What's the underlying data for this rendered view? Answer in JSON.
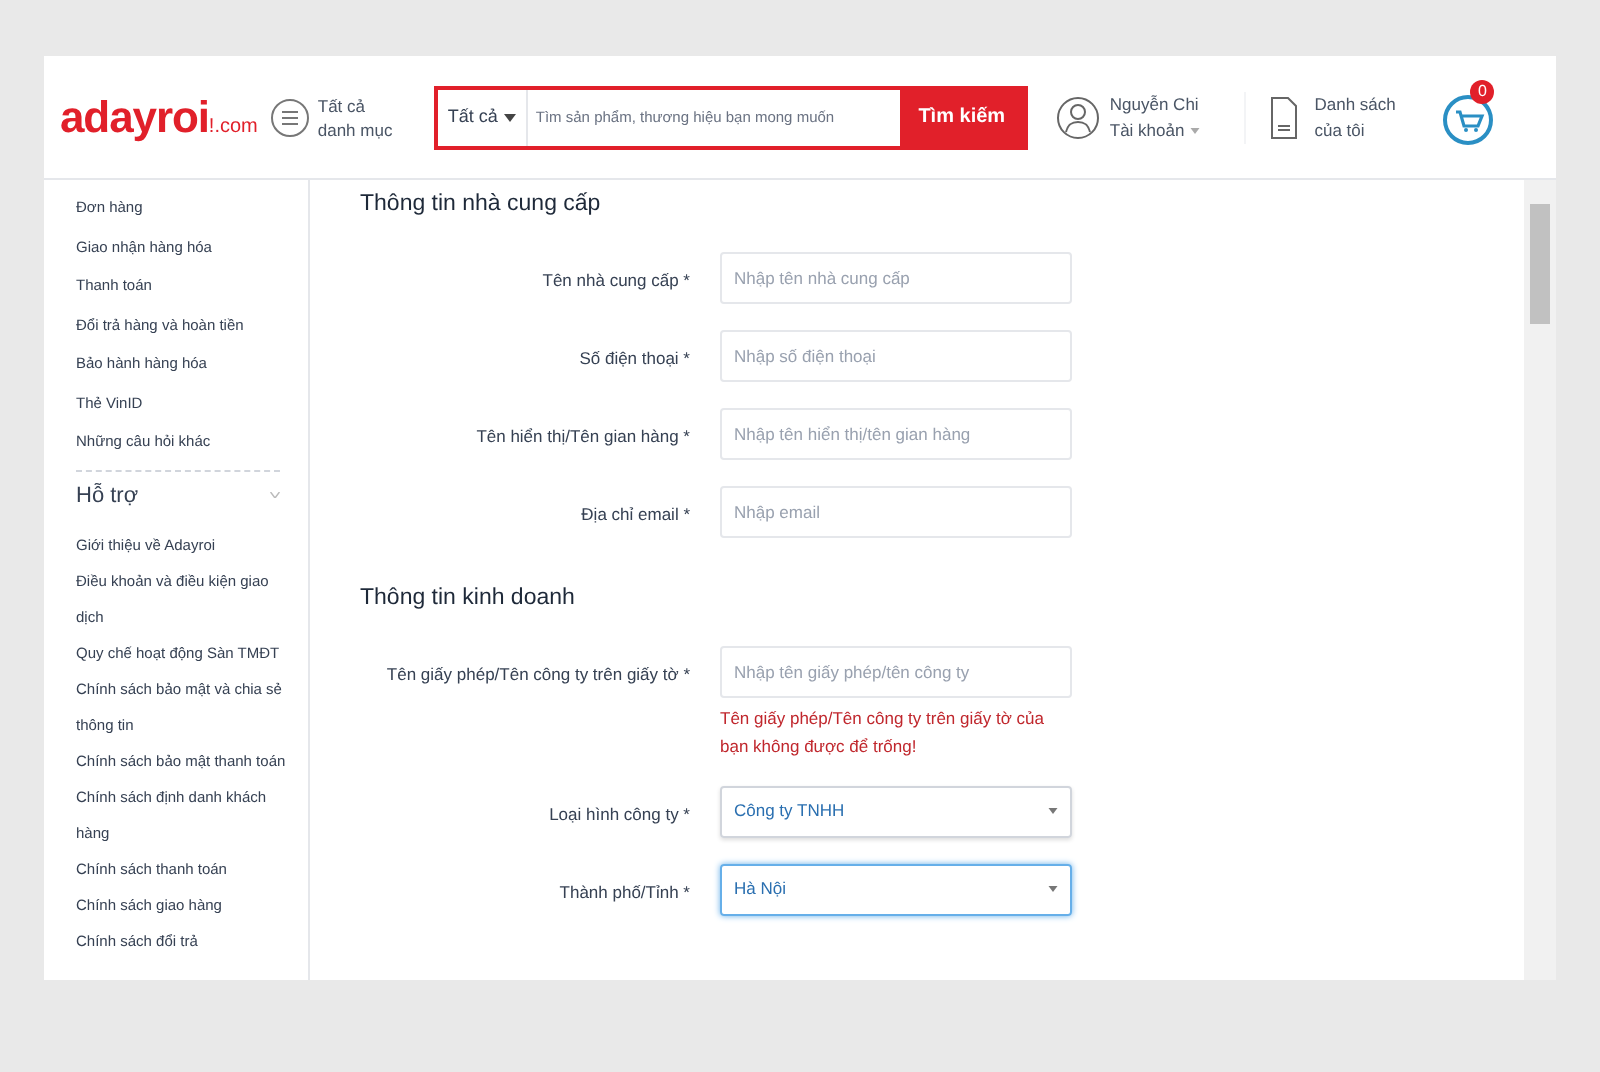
{
  "header": {
    "logo": {
      "main": "adayroi",
      "suffix": "!.com"
    },
    "categories": "Tất cả danh mục",
    "search": {
      "scope": "Tất cả",
      "placeholder": "Tìm sản phẩm, thương hiệu bạn mong muốn",
      "button": "Tìm kiếm"
    },
    "account": {
      "name": "Nguyễn Chi",
      "label": "Tài khoản"
    },
    "wishlist": "Danh sách của tôi",
    "cart_count": "0"
  },
  "sidebar": {
    "items": [
      "Đơn hàng",
      "Giao nhận hàng hóa",
      "Thanh toán",
      "Đổi trả hàng và hoàn tiền",
      "Bảo hành hàng hóa",
      "Thẻ VinID",
      "Những câu hỏi khác"
    ],
    "section": {
      "title": "Hỗ trợ",
      "expanded": true,
      "items": [
        "Giới thiệu về Adayroi",
        "Điều khoản và điều kiện giao dịch",
        "Quy chế hoạt động Sàn TMĐT",
        "Chính sách bảo mật và chia sẻ thông tin",
        "Chính sách bảo mật thanh toán",
        "Chính sách định danh khách hàng",
        "Chính sách thanh toán",
        "Chính sách giao hàng",
        "Chính sách đổi trả"
      ]
    }
  },
  "sections": [
    {
      "title": "Thông tin nhà cung cấp",
      "fields": [
        {
          "kind": "text",
          "label": "Tên nhà cung cấp *",
          "placeholder": "Nhập tên nhà cung cấp"
        },
        {
          "kind": "text",
          "label": "Số điện thoại *",
          "placeholder": "Nhập số điện thoại"
        },
        {
          "kind": "text",
          "label": "Tên hiển thị/Tên gian hàng *",
          "placeholder": "Nhập tên hiển thị/tên gian hàng"
        },
        {
          "kind": "text",
          "label": "Địa chỉ email *",
          "placeholder": "Nhập email"
        }
      ]
    },
    {
      "title": "Thông tin kinh doanh",
      "fields": [
        {
          "kind": "text",
          "label": "Tên giấy phép/Tên công ty trên giấy tờ *",
          "placeholder": "Nhập tên giấy phép/tên công ty",
          "error": "Tên giấy phép/Tên công ty trên giấy tờ của bạn không được để trống!"
        },
        {
          "kind": "select",
          "label": "Loại hình công ty *",
          "value": "Công ty TNHH",
          "focused": false
        },
        {
          "kind": "select",
          "label": "Thành phố/Tỉnh *",
          "value": "Hà Nội",
          "focused": true
        }
      ]
    }
  ]
}
